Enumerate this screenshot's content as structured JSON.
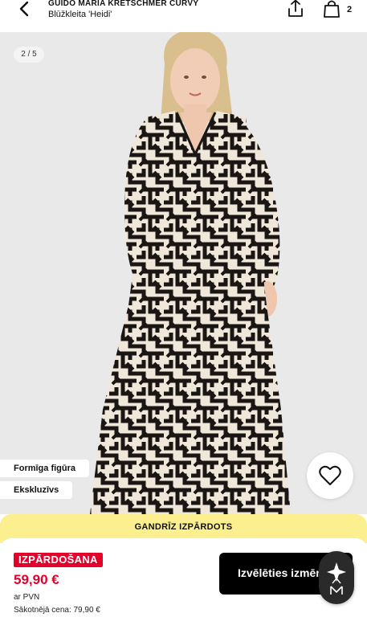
{
  "header": {
    "brand": "GUIDO MARIA KRETSCHMER CURVY",
    "product_name": "Blūžkleita 'Heidi'",
    "bag_count": "2",
    "icons": [
      "back-arrow-icon",
      "share-icon",
      "shopping-bag-icon"
    ]
  },
  "gallery": {
    "counter": "2 / 5",
    "tags": [
      "Formīga figūra",
      "Ekskluzīvs"
    ],
    "wishlist_icon": "heart-icon"
  },
  "banner": {
    "text": "GANDRĪZ IZPĀRDOTS",
    "color": "#fbef8f"
  },
  "purchase": {
    "sale_badge": "IZPĀRDOŠANA",
    "price": "59,90 €",
    "vat_note": "ar PVN",
    "original_price": "Sākotnējā cena: 79,90 €",
    "select_button": "Izvēlēties izmēru",
    "assistant_icon": "sparkle-assistant-icon"
  },
  "colors": {
    "sale_red": "#e4002b",
    "button_black": "#000000",
    "banner_yellow": "#fbef8f"
  }
}
